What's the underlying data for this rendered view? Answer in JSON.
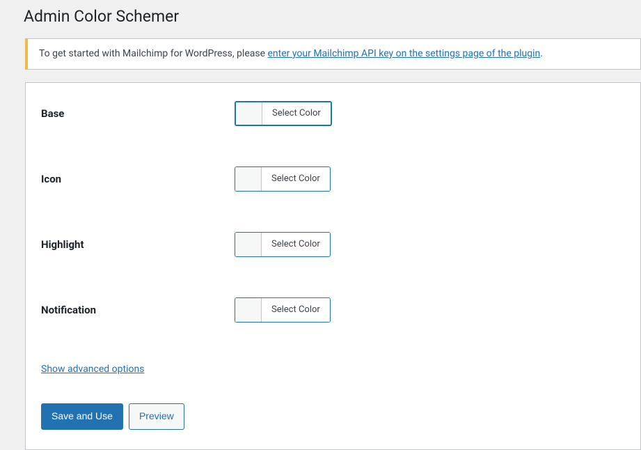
{
  "page": {
    "title": "Admin Color Schemer"
  },
  "notice": {
    "text_before": "To get started with Mailchimp for WordPress, please ",
    "link_text": "enter your Mailchimp API key on the settings page of the plugin",
    "text_after": "."
  },
  "fields": {
    "base": {
      "label": "Base",
      "button_text": "Select Color"
    },
    "icon": {
      "label": "Icon",
      "button_text": "Select Color"
    },
    "highlight": {
      "label": "Highlight",
      "button_text": "Select Color"
    },
    "notification": {
      "label": "Notification",
      "button_text": "Select Color"
    }
  },
  "links": {
    "advanced": "Show advanced options"
  },
  "buttons": {
    "save": "Save and Use",
    "preview": "Preview"
  }
}
